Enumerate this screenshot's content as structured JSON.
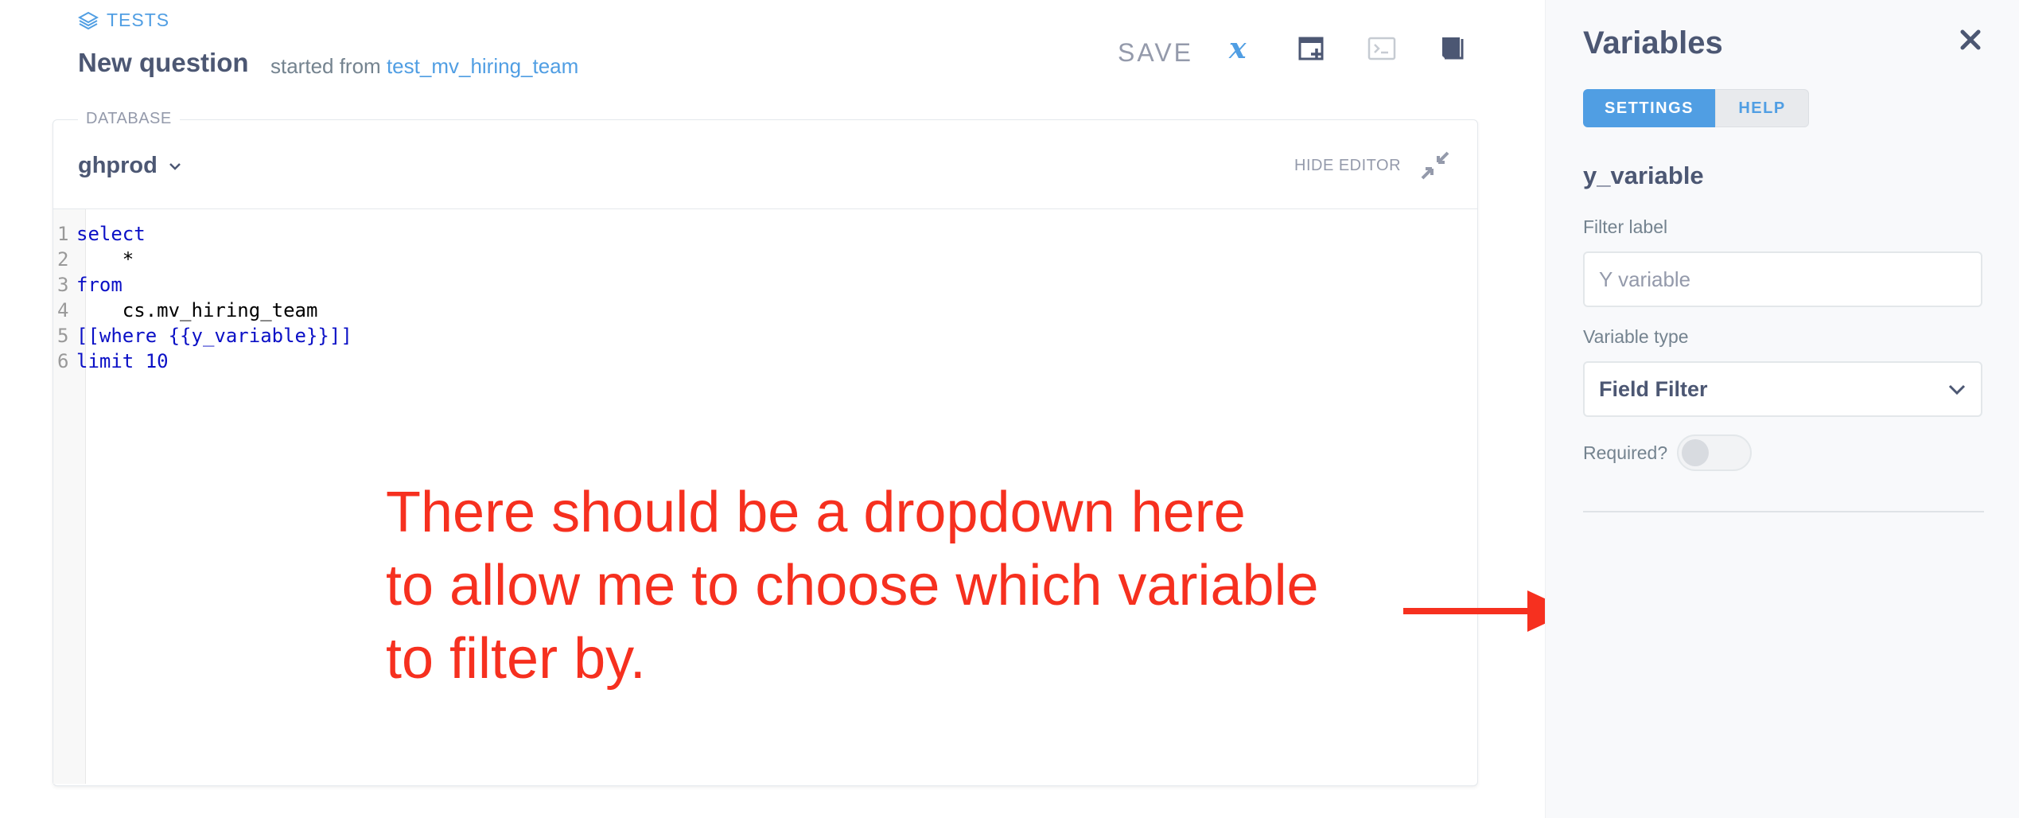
{
  "header": {
    "collection": "TESTS",
    "title": "New question",
    "started_prefix": "started from",
    "started_link": "test_mv_hiring_team",
    "save_label": "SAVE"
  },
  "editor": {
    "database_label": "DATABASE",
    "database_value": "ghprod",
    "hide_editor_label": "HIDE EDITOR",
    "lines": [
      {
        "num": "1",
        "text": "select"
      },
      {
        "num": "2",
        "text": "    *"
      },
      {
        "num": "3",
        "text": "from"
      },
      {
        "num": "4",
        "text": "    cs.mv_hiring_team"
      },
      {
        "num": "5",
        "text": "[[where {{y_variable}}]]"
      },
      {
        "num": "6",
        "text": "limit 10"
      }
    ]
  },
  "annotation": {
    "line1": "There should be a dropdown here",
    "line2": "to allow me to choose which variable",
    "line3": "to filter by."
  },
  "sidebar": {
    "title": "Variables",
    "tab_settings": "SETTINGS",
    "tab_help": "HELP",
    "variable_name": "y_variable",
    "filter_label_caption": "Filter label",
    "filter_label_placeholder": "Y variable",
    "variable_type_caption": "Variable type",
    "variable_type_value": "Field Filter",
    "required_caption": "Required?"
  },
  "colors": {
    "brand": "#509ee3",
    "annotation": "#f6301f",
    "text": "#4c5773"
  }
}
